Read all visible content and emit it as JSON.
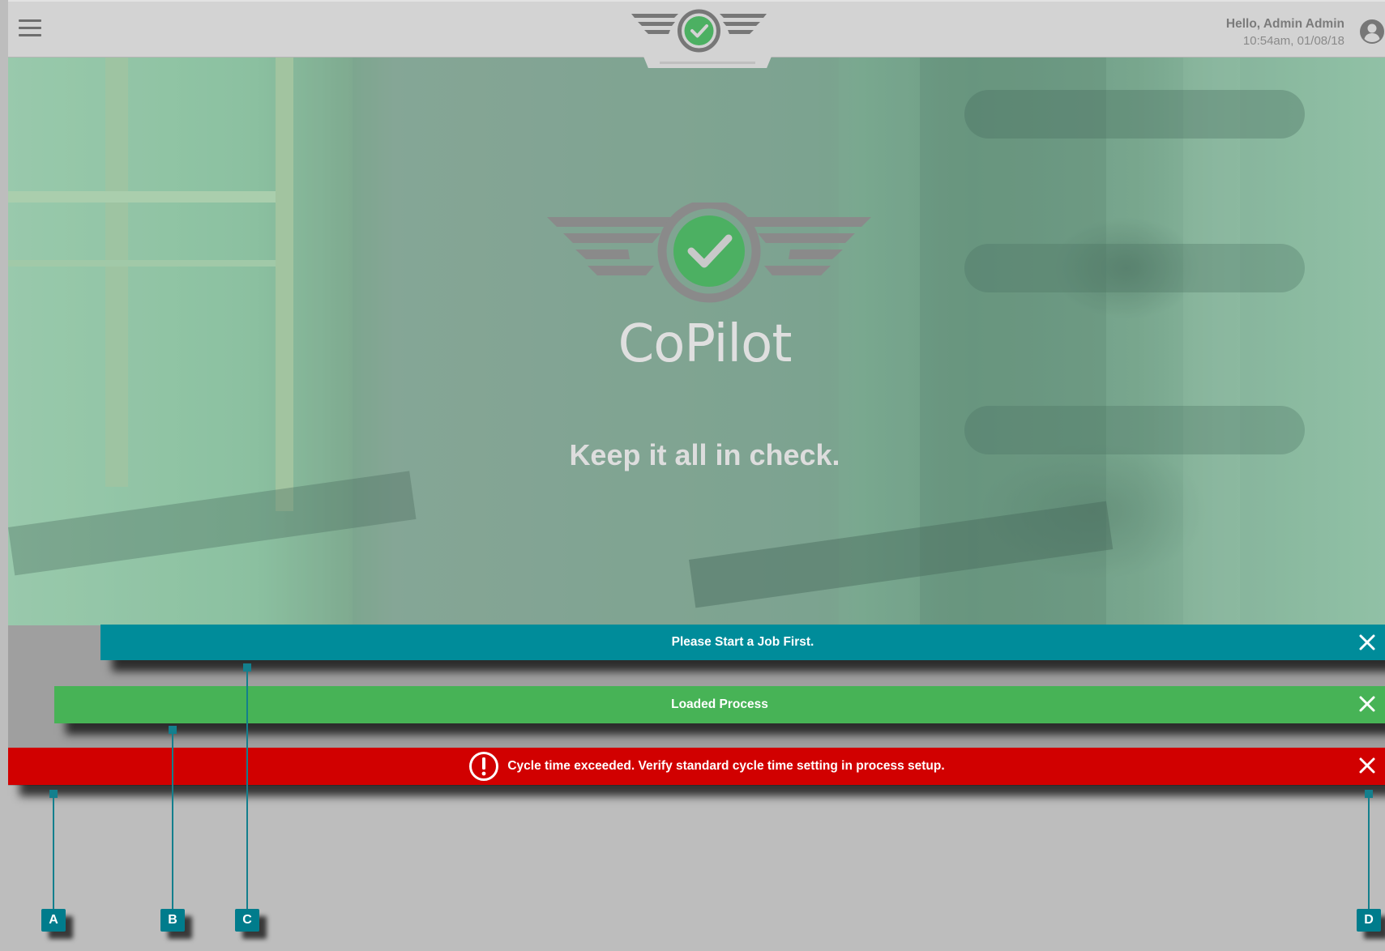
{
  "header": {
    "greeting": "Hello, Admin Admin",
    "datetime": "10:54am, 01/08/18",
    "menu_icon": "hamburger-menu-icon",
    "user_icon": "user-account-icon",
    "logo_icon": "copilot-wings-check-logo"
  },
  "hero": {
    "brand_name": "CoPilot",
    "tagline": "Keep it all in check."
  },
  "notifications": [
    {
      "type": "info",
      "text": "Please Start a Job First.",
      "color": "#008c9a"
    },
    {
      "type": "success",
      "text": "Loaded Process",
      "color": "#47b356"
    },
    {
      "type": "error",
      "text": "Cycle time exceeded. Verify standard cycle time setting in process setup.",
      "color": "#d10000",
      "icon": "exclamation-circle-icon"
    }
  ],
  "callouts": [
    "A",
    "B",
    "C",
    "D"
  ],
  "colors": {
    "topbar": "#d3d3d3",
    "accent_teal": "#008c9a",
    "success_green": "#47b356",
    "error_red": "#d10000",
    "callout": "#007c8c"
  }
}
